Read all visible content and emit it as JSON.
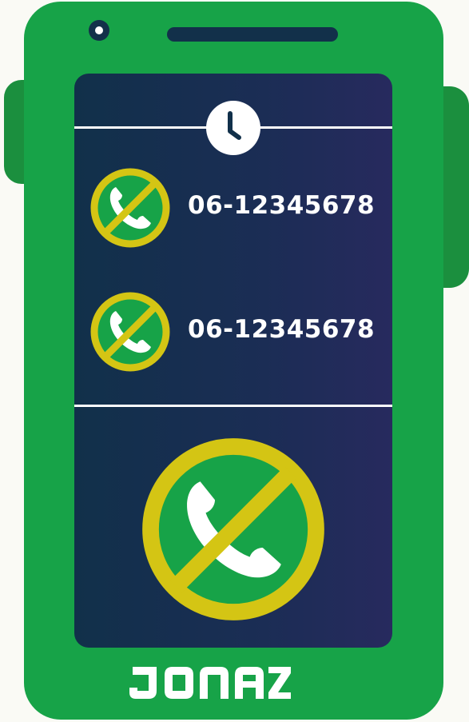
{
  "calls": [
    {
      "number": "06-12345678",
      "icon": "blocked-call-icon"
    },
    {
      "number": "06-12345678",
      "icon": "blocked-call-icon"
    }
  ],
  "brand": {
    "logo_text": "JONAZ"
  },
  "colors": {
    "phone_body": "#17a348",
    "phone_side": "#1b8f3e",
    "screen_left": "#11304a",
    "screen_right": "#272a5e",
    "prohibition_ring": "#d4c514",
    "text": "#ffffff",
    "background": "#fafaf5"
  }
}
